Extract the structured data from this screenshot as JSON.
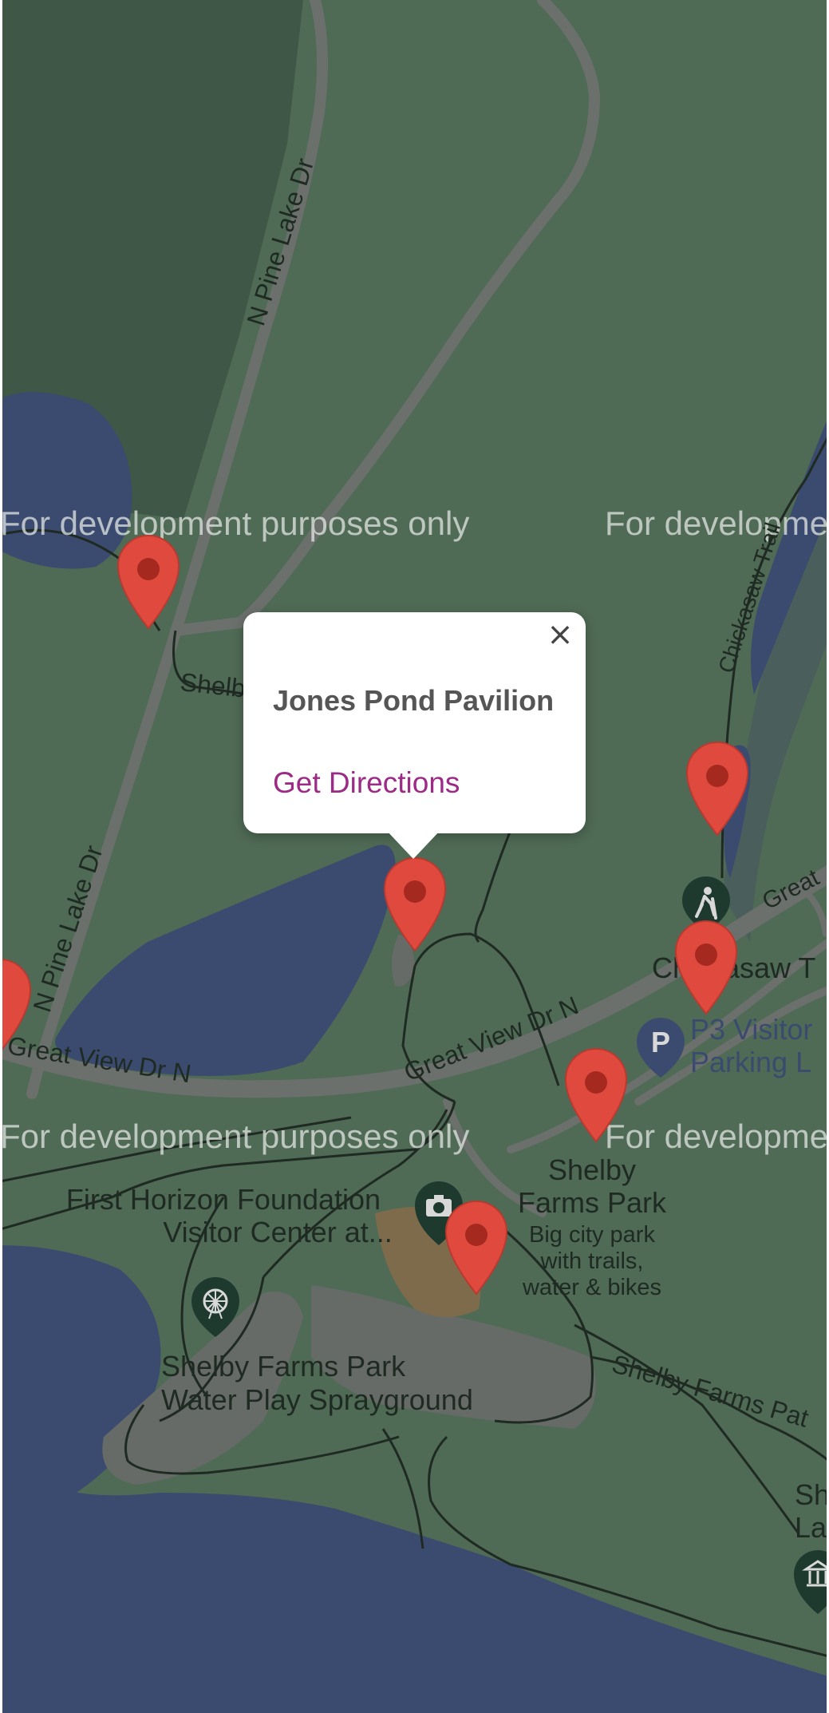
{
  "map": {
    "watermark": "For development purposes only",
    "roads": {
      "n_pine_lake_dr": "N Pine Lake Dr",
      "great_view_dr_n": "Great View Dr N",
      "great_partial": "Great",
      "shelby_partial": "Shelb",
      "chickasaw_trail": "Chickasaw Trail",
      "shelby_farms_path": "Shelby Farms Pat"
    },
    "places": {
      "chickasaw_label": "Chickasaw T",
      "p3_line1": "P3 Visitor",
      "p3_line2": "Parking L",
      "shelby_farms_line1": "Shelby",
      "shelby_farms_line2": "Farms Park",
      "shelby_farms_desc1": "Big city park",
      "shelby_farms_desc2": "with trails,",
      "shelby_farms_desc3": "water & bikes",
      "first_horizon_line1": "First Horizon Foundation",
      "first_horizon_line2": "Visitor Center at...",
      "sprayground_line1": "Shelby Farms Park",
      "sprayground_line2": "Water Play Sprayground",
      "shel_partial1": "Shel",
      "shel_partial2": "Law"
    },
    "icons": {
      "parking": "P",
      "hiking": "hiking-icon",
      "camera": "camera-icon",
      "ferris_wheel": "ferris-wheel-icon",
      "museum": "museum-icon"
    },
    "colors": {
      "land": "#4f6a55",
      "dark_land": "#3f5747",
      "water": "#3b4b6f",
      "road": "#6b706d",
      "marker": "#e0493d",
      "marker_dot": "#a5291f",
      "poi_dark": "#1e3a2e",
      "poi_blue": "#3b4b6f",
      "link": "#9c2b86"
    }
  },
  "popup": {
    "title": "Jones Pond Pavilion",
    "link": "Get Directions",
    "close": "×"
  }
}
